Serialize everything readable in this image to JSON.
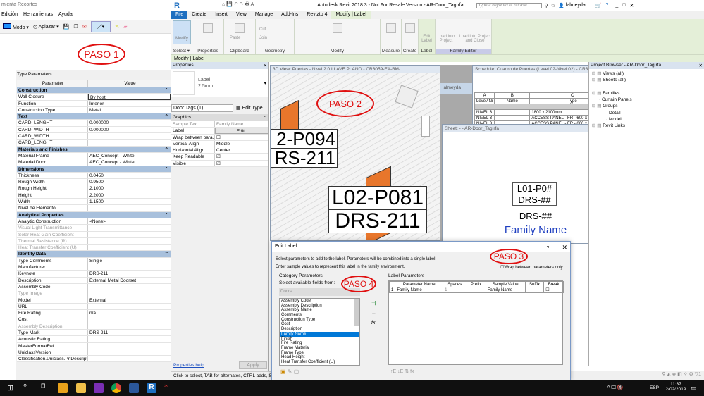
{
  "snip": {
    "title": "mienta Recortes",
    "menu": [
      "Edición",
      "Herramientas",
      "Ayuda"
    ],
    "toolbar": {
      "mode": "Modo",
      "delay": "Aplazar"
    },
    "paso": "PASO 1"
  },
  "type_params": {
    "title": "Type Parameters",
    "headers": [
      "Parameter",
      "Value"
    ],
    "rows": [
      {
        "s": "Construction"
      },
      {
        "p": "Wall Closure",
        "v": "By host"
      },
      {
        "p": "Function",
        "v": "Interior"
      },
      {
        "p": "Construction Type",
        "v": "Metal"
      },
      {
        "s": "Text"
      },
      {
        "p": "CARD_LENGHT",
        "v": "0.000000"
      },
      {
        "p": "CARD_WIDTH",
        "v": "0.000000"
      },
      {
        "p": "CARD_WIDTH",
        "v": ""
      },
      {
        "p": "CARD_LENGHT",
        "v": ""
      },
      {
        "s": "Materials and Finishes"
      },
      {
        "p": "Material Frame",
        "v": "AEC_Concept - White"
      },
      {
        "p": "Material Door",
        "v": "AEC_Concept - White"
      },
      {
        "s": "Dimensions"
      },
      {
        "p": "Thickness",
        "v": "0.0450"
      },
      {
        "p": "Rough Width",
        "v": "0.9500"
      },
      {
        "p": "Rough Height",
        "v": "2.1000"
      },
      {
        "p": "Height",
        "v": "2.2000"
      },
      {
        "p": "Width",
        "v": "1.1500"
      },
      {
        "p": "Nivel de Elemento",
        "v": ""
      },
      {
        "s": "Analytical Properties"
      },
      {
        "p": "Analytic Construction",
        "v": "<None>"
      },
      {
        "p": "Visual Light Transmittance",
        "v": "",
        "d": true
      },
      {
        "p": "Solar Heat Gain Coefficient",
        "v": "",
        "d": true
      },
      {
        "p": "Thermal Resistance (R)",
        "v": "",
        "d": true
      },
      {
        "p": "Heat Transfer Coefficient (U)",
        "v": "",
        "d": true
      },
      {
        "s": "Identity Data"
      },
      {
        "p": "Type Comments",
        "v": "Single"
      },
      {
        "p": "Manufacturer",
        "v": ""
      },
      {
        "p": "Keynote",
        "v": "DRS-211"
      },
      {
        "p": "Description",
        "v": "External Metal Doorset"
      },
      {
        "p": "Assembly Code",
        "v": ""
      },
      {
        "p": "Type Image",
        "v": "",
        "d": true
      },
      {
        "p": "Model",
        "v": "External"
      },
      {
        "p": "URL",
        "v": ""
      },
      {
        "p": "Fire Rating",
        "v": "n/a"
      },
      {
        "p": "Cost",
        "v": ""
      },
      {
        "p": "Assembly Description",
        "v": "",
        "d": true
      },
      {
        "p": "Type Mark",
        "v": "DRS-211"
      },
      {
        "p": "Acoustic Rating",
        "v": ""
      },
      {
        "p": "MasterFormatRef",
        "v": ""
      },
      {
        "p": "UniclassVersion",
        "v": ""
      },
      {
        "p": "Classification.Uniclass.Pr.Descriptio",
        "v": ""
      }
    ]
  },
  "revit": {
    "title": "Autodesk Revit 2018.3 - Not For Resale Version -   AR-Door_Tag.rfa",
    "search_placeholder": "Type a keyword or phrase",
    "user": "lalmeyda",
    "tabs": [
      "File",
      "Create",
      "Insert",
      "View",
      "Manage",
      "Add-Ins",
      "Revizto 4",
      "Modify | Label"
    ],
    "ribbon_panels": [
      "Select ▾",
      "Properties",
      "Clipboard",
      "Geometry",
      "Modify",
      "Measure",
      "Create",
      "Label",
      "Family Editor"
    ],
    "ribbon_buttons": {
      "modify": "Modify",
      "paste": "Paste",
      "cut": "Cut",
      "join": "Join",
      "edit_label": "Edit Label",
      "load_project": "Load into Project",
      "load_close": "Load into Project and Close"
    },
    "context": "Modify | Label"
  },
  "properties": {
    "title": "Properties",
    "type_name": "Label",
    "type_size": "2.5mm",
    "selector": "Door Tags (1)",
    "edit_type": "Edit Type",
    "section": "Graphics",
    "rows": [
      {
        "p": "Sample Text",
        "v": "Family Name..."
      },
      {
        "p": "Label",
        "v": "Edit..."
      },
      {
        "p": "Wrap between para...",
        "v": ""
      },
      {
        "p": "Vertical Align",
        "v": "Middle"
      },
      {
        "p": "Horizontal Align",
        "v": "Center"
      },
      {
        "p": "Keep Readable",
        "v": "☑"
      },
      {
        "p": "Visible",
        "v": "☑"
      }
    ],
    "help": "Properties help",
    "apply": "Apply"
  },
  "view3d": {
    "title": "3D View: Puertas - Nivel 2.0 LLAVE PLANO - CR3059-EA-BM-...",
    "tag1": [
      "2-P094",
      "RS-211"
    ],
    "tag2": [
      "L02-P081",
      "DRS-211"
    ],
    "paso": "PASO 2"
  },
  "background_tab": "lalmeyda",
  "schedule": {
    "title": "Schedule: Cuadro de Puertas (Level 02-Nivel 02) - CR30",
    "cols": [
      "A",
      "B",
      "C"
    ],
    "heads": [
      "Level/ Ni",
      "Name",
      "Type"
    ],
    "rows": [
      [
        "NIVEL 3",
        "",
        "1800 x 2100mm"
      ],
      [
        "NIVEL 3",
        "",
        "ACCESS PANEL - FR - 600 x 2100mm"
      ],
      [
        "NIVEL 3",
        "",
        "ACCESS PANEL - FR - 600 x 2100mm"
      ]
    ]
  },
  "sheet": {
    "title": "Sheet: - - AR-Door_Tag.rfa",
    "tag": [
      "L01-P0#",
      "DRS-##"
    ],
    "label1": "DRS-##",
    "label2": "Family Name"
  },
  "project_browser": {
    "title": "Project Browser - AR-Door_Tag.rfa",
    "items": [
      {
        "t": "Views (all)",
        "l": 0
      },
      {
        "t": "Sheets (all)",
        "l": 0
      },
      {
        "t": "-",
        "l": 2
      },
      {
        "t": "Families",
        "l": 0
      },
      {
        "t": "Curtain Panels",
        "l": 1
      },
      {
        "t": "Groups",
        "l": 0
      },
      {
        "t": "Detail",
        "l": 2
      },
      {
        "t": "Model",
        "l": 2
      },
      {
        "t": "Revit Links",
        "l": 0
      }
    ]
  },
  "edit_label": {
    "title": "Edit Label",
    "help": "?",
    "line1": "Select parameters to add to the label.  Parameters will be combined into a single label.",
    "line2": "Enter sample values to represent this label in the family environment.",
    "wrap": "Wrap between parameters only",
    "category_group": "Category Parameters",
    "select_from": "Select available fields from:",
    "category": "Doors",
    "fields": [
      "Assembly Code",
      "Assembly Description",
      "Assembly Name",
      "Comments",
      "Construction Type",
      "Cost",
      "Description",
      "Family Name",
      "Finish",
      "Fire Rating",
      "Frame Material",
      "Frame Type",
      "Head Height",
      "Heat Transfer Coefficient (U)"
    ],
    "selected_field": "Family Name",
    "label_group": "Label Parameters",
    "headers": [
      "",
      "Parameter Name",
      "Spaces",
      "Prefix",
      "Sample Value",
      "Suffix",
      "Break"
    ],
    "rows": [
      [
        "1",
        "Family Name",
        "1",
        "",
        "Family Name",
        "",
        ""
      ]
    ],
    "paso3": "PASO 3",
    "paso4": "PASO 4"
  },
  "status": "Click to select, TAB for alternates, CTRL adds, SHIFT",
  "filter_count": "1",
  "taskbar": {
    "lang": "ESP",
    "time": "11:37",
    "date": "2/02/2019"
  },
  "colors": {
    "accent": "#1e6fc0",
    "ribbon": "#e4efd8",
    "section": "#a8c0dc",
    "paso": "#e01010",
    "door": "#e8762b",
    "family_name": "#1f3fc0"
  }
}
